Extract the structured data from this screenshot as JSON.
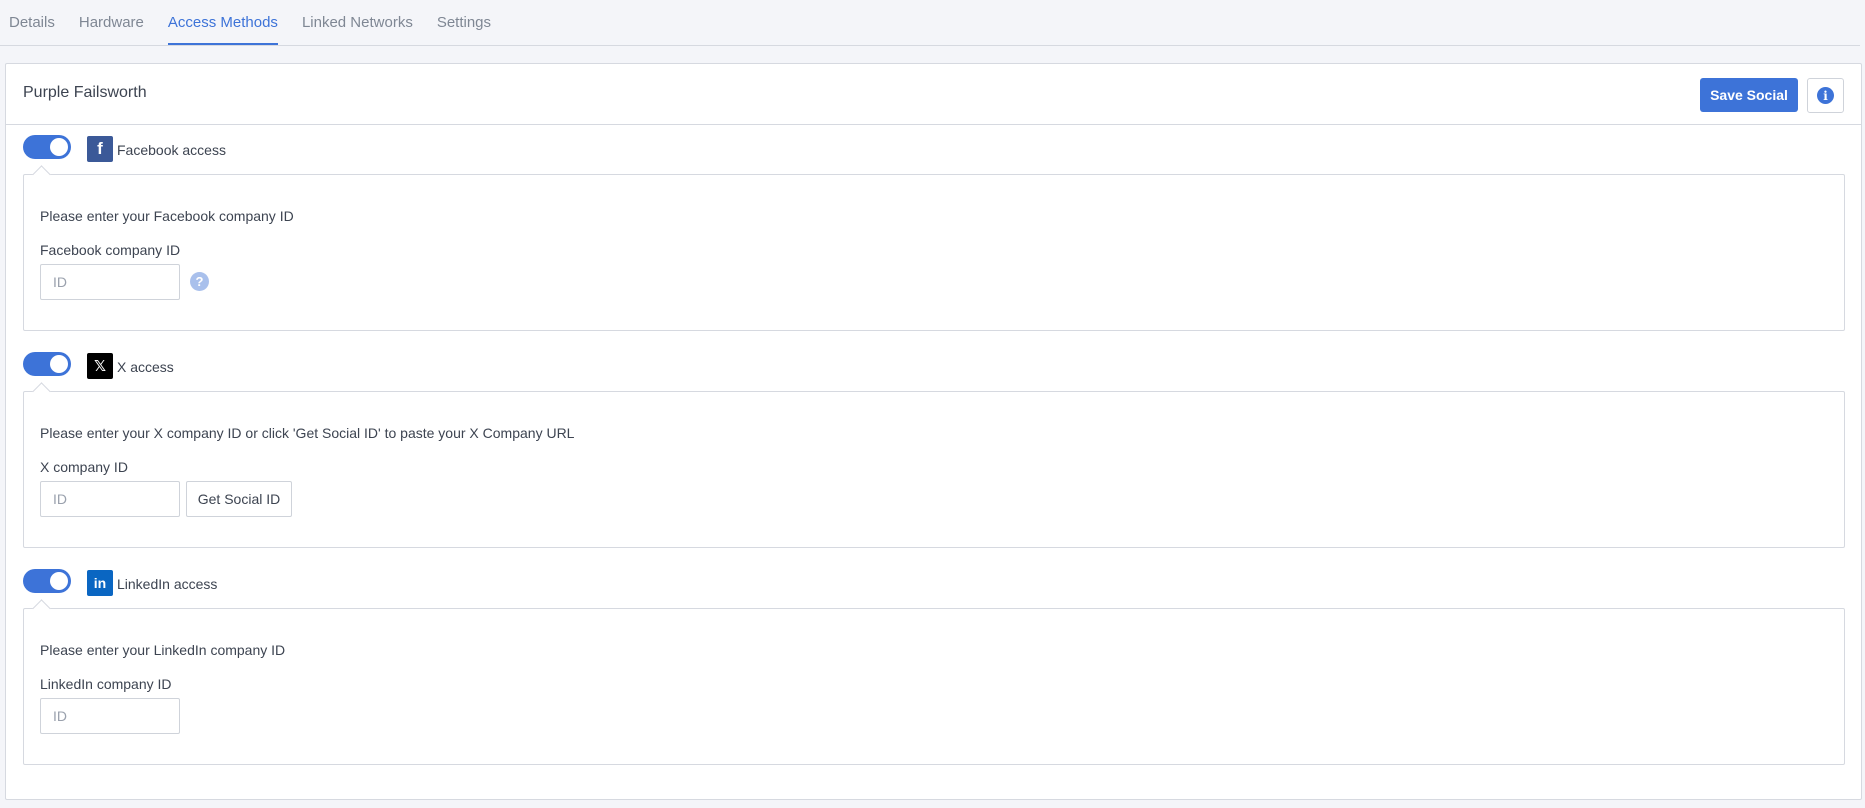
{
  "tabs": [
    {
      "label": "Details"
    },
    {
      "label": "Hardware"
    },
    {
      "label": "Access Methods"
    },
    {
      "label": "Linked Networks"
    },
    {
      "label": "Settings"
    }
  ],
  "active_tab": "Access Methods",
  "panel": {
    "title": "Purple Failsworth",
    "save_label": "Save Social",
    "info_icon_glyph": "i"
  },
  "sections": {
    "facebook": {
      "label": "Facebook access",
      "icon_glyph": "f",
      "enabled": true,
      "description": "Please enter your Facebook company ID",
      "field_label": "Facebook company ID",
      "input_value": "",
      "input_placeholder": "ID",
      "help_glyph": "?"
    },
    "x": {
      "label": "X access",
      "icon_glyph": "𝕏",
      "enabled": true,
      "description": "Please enter your X company ID or click 'Get Social ID' to paste your X Company URL",
      "field_label": "X company ID",
      "input_value": "",
      "input_placeholder": "ID",
      "button_label": "Get Social ID"
    },
    "linkedin": {
      "label": "LinkedIn access",
      "icon_glyph": "in",
      "enabled": true,
      "description": "Please enter your LinkedIn company ID",
      "field_label": "LinkedIn company ID",
      "input_value": "",
      "input_placeholder": "ID"
    }
  },
  "colors": {
    "accent": "#3d73d8",
    "facebook": "#3b5998",
    "x": "#000000",
    "linkedin": "#0a66c2",
    "help": "#a9c0ec"
  },
  "icons": {
    "facebook": "facebook-icon",
    "x": "x-icon",
    "linkedin": "linkedin-icon",
    "info": "info-icon",
    "help": "help-icon"
  }
}
